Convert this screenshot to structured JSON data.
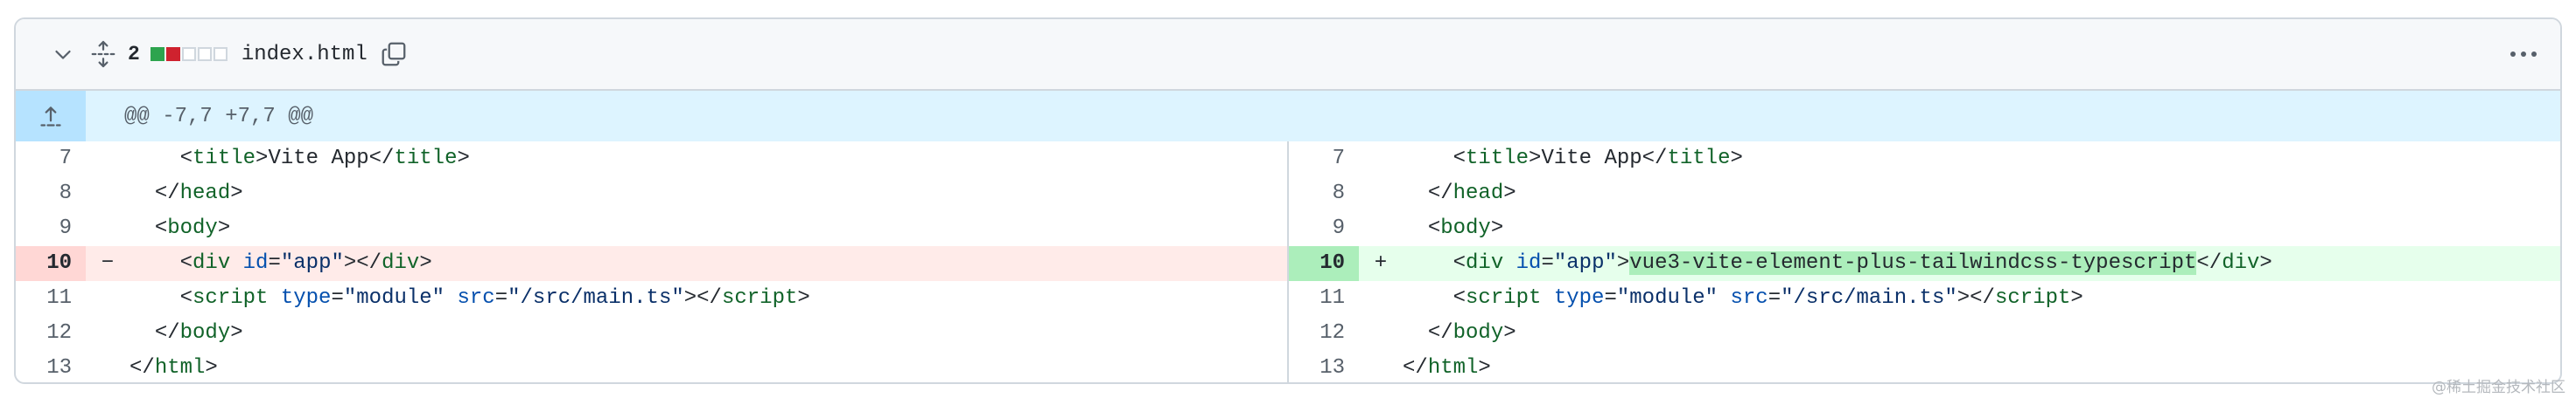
{
  "file": {
    "changes_count": "2",
    "file_name": "index.html",
    "diffstat": [
      "add",
      "del",
      "neu",
      "neu",
      "neu"
    ]
  },
  "icons": {
    "collapse": "chevron-down-icon",
    "expand": "unfold-icon",
    "copy": "copy-icon",
    "more": "kebab-horizontal-icon",
    "hunk_expand": "fold-up-icon"
  },
  "hunk": {
    "header": "@@ -7,7 +7,7 @@"
  },
  "left": {
    "lines": [
      {
        "num": "7",
        "marker": "",
        "type": "ctx"
      },
      {
        "num": "8",
        "marker": "",
        "type": "ctx"
      },
      {
        "num": "9",
        "marker": "",
        "type": "ctx"
      },
      {
        "num": "10",
        "marker": "−",
        "type": "del"
      },
      {
        "num": "11",
        "marker": "",
        "type": "ctx"
      },
      {
        "num": "12",
        "marker": "",
        "type": "ctx"
      },
      {
        "num": "13",
        "marker": "",
        "type": "ctx"
      }
    ]
  },
  "right": {
    "lines": [
      {
        "num": "7",
        "marker": "",
        "type": "ctx"
      },
      {
        "num": "8",
        "marker": "",
        "type": "ctx"
      },
      {
        "num": "9",
        "marker": "",
        "type": "ctx"
      },
      {
        "num": "10",
        "marker": "+",
        "type": "add"
      },
      {
        "num": "11",
        "marker": "",
        "type": "ctx"
      },
      {
        "num": "12",
        "marker": "",
        "type": "ctx"
      },
      {
        "num": "13",
        "marker": "",
        "type": "ctx"
      }
    ]
  },
  "code": {
    "l7_indent": "    ",
    "l7_open_lt": "<",
    "l7_open_tag": "title",
    "l7_open_gt": ">",
    "l7_text": "Vite App",
    "l7_close_lt": "</",
    "l7_close_tag": "title",
    "l7_close_gt": ">",
    "l8_indent": "  ",
    "l8_lt": "</",
    "l8_tag": "head",
    "l8_gt": ">",
    "l9_indent": "  ",
    "l9_lt": "<",
    "l9_tag": "body",
    "l9_gt": ">",
    "l10_indent": "    ",
    "l10_lt": "<",
    "l10_tag": "div",
    "l10_sp": " ",
    "l10_attr": "id",
    "l10_eq": "=",
    "l10_val": "\"app\"",
    "l10_gt": ">",
    "l10_added_text": "vue3-vite-element-plus-tailwindcss-typescript",
    "l10_close_lt": "</",
    "l10_close_tag": "div",
    "l10_close_gt": ">",
    "l11_indent": "    ",
    "l11_lt": "<",
    "l11_tag": "script",
    "l11_sp1": " ",
    "l11_attr1": "type",
    "l11_eq1": "=",
    "l11_val1": "\"module\"",
    "l11_sp2": " ",
    "l11_attr2": "src",
    "l11_eq2": "=",
    "l11_val2": "\"/src/main.ts\"",
    "l11_gt": ">",
    "l11_close_lt": "</",
    "l11_close_tag": "script",
    "l11_close_gt": ">",
    "l12_indent": "  ",
    "l12_lt": "</",
    "l12_tag": "body",
    "l12_gt": ">",
    "l13_indent": "",
    "l13_lt": "</",
    "l13_tag": "html",
    "l13_gt": ">"
  },
  "watermark": "@稀土掘金技术社区"
}
